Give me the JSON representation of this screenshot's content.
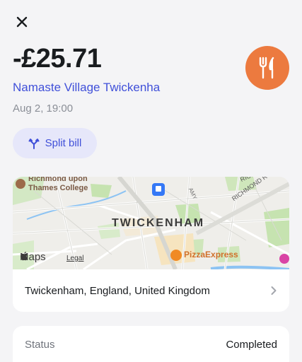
{
  "header": {
    "close_icon": "close-icon"
  },
  "transaction": {
    "amount": "-£25.71",
    "merchant": "Namaste Village Twickenha",
    "datetime": "Aug 2, 19:00",
    "category_icon": "fork-knife-icon",
    "category_color": "#ec7a3f"
  },
  "actions": {
    "split_label": "Split bill",
    "split_icon": "split-icon"
  },
  "map": {
    "place_label": "TWICKENHAM",
    "college_label_line1": "Richmond upon",
    "college_label_line2": "Thames College",
    "poi_label": "PizzaExpress",
    "road_label_1": "RICHMOND RO",
    "road_label_2": "RICHMOND RO",
    "road_label_3": "AMY",
    "maps_brand": "Maps",
    "legal_label": "Legal"
  },
  "location": {
    "text": "Twickenham, England, United Kingdom"
  },
  "details": {
    "status_key": "Status",
    "status_value": "Completed"
  },
  "colors": {
    "accent": "#4050d9",
    "accent_bg": "#e6e7fa",
    "background": "#f4f4f6"
  }
}
